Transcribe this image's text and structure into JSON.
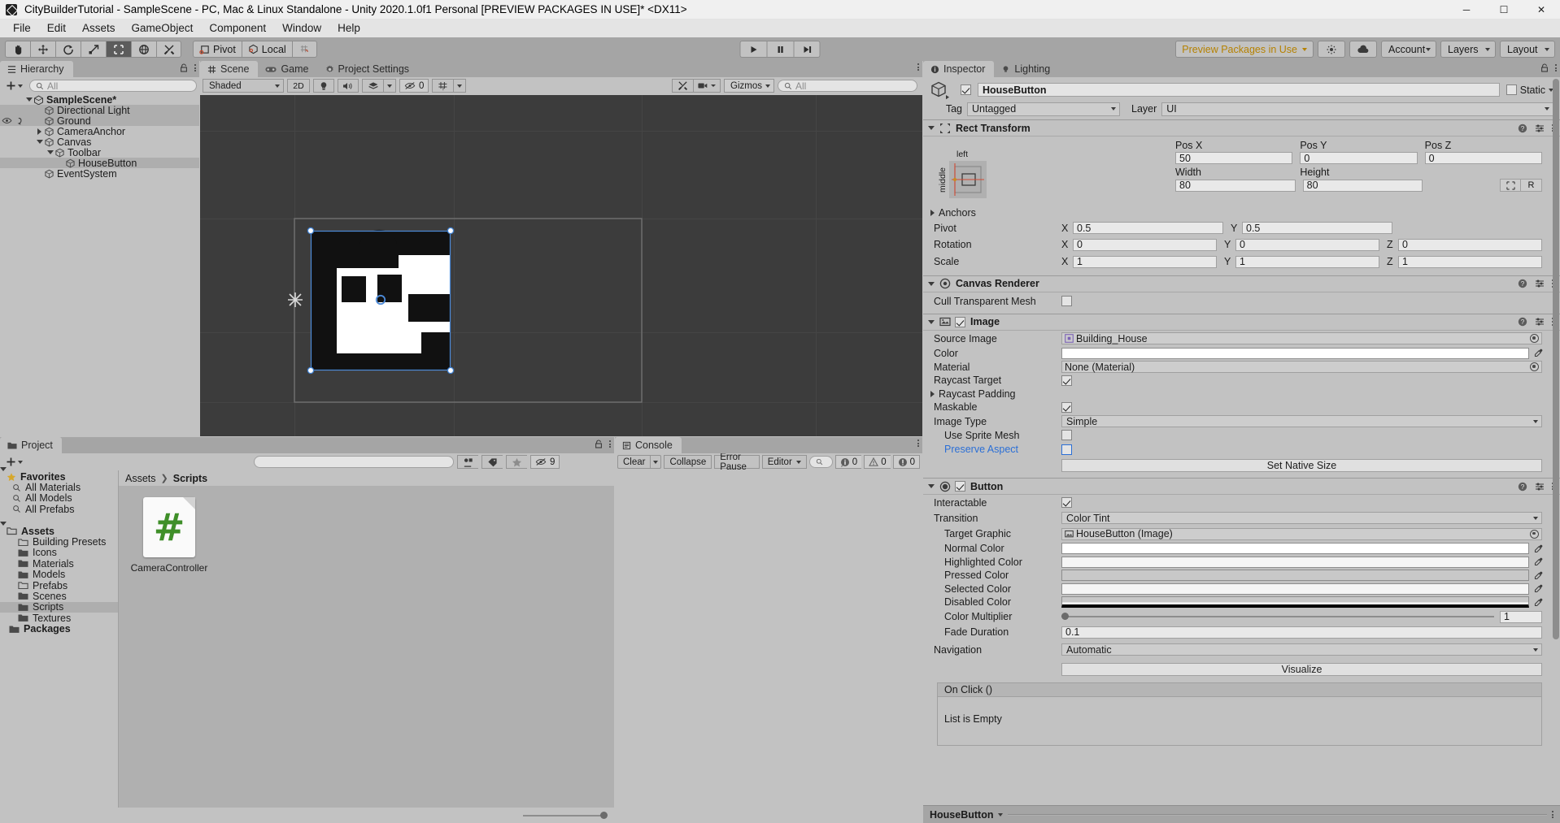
{
  "window": {
    "title": "CityBuilderTutorial - SampleScene - PC, Mac & Linux Standalone - Unity 2020.1.0f1 Personal [PREVIEW PACKAGES IN USE]* <DX11>",
    "minimize": "─",
    "maximize": "☐",
    "close": "✕"
  },
  "menu": {
    "items": [
      "File",
      "Edit",
      "Assets",
      "GameObject",
      "Component",
      "Window",
      "Help"
    ]
  },
  "toolbar": {
    "tools": [
      {
        "name": "hand-tool",
        "icon": "hand-icon",
        "active": false
      },
      {
        "name": "move-tool",
        "icon": "move-icon",
        "active": false
      },
      {
        "name": "rotate-tool",
        "icon": "rotate-icon",
        "active": false
      },
      {
        "name": "scale-tool",
        "icon": "scale-icon",
        "active": false
      },
      {
        "name": "rect-tool",
        "icon": "rect-icon",
        "active": true
      },
      {
        "name": "transform-tool",
        "icon": "transform-icon",
        "active": false
      },
      {
        "name": "custom-tool",
        "icon": "wrench-icon",
        "active": false
      }
    ],
    "pivot_label": "Pivot",
    "local_label": "Local",
    "grid_snap_label": "",
    "play": "▶",
    "pause": "‖",
    "step": "▶|",
    "preview_packages": "Preview Packages in Use",
    "account": "Account",
    "layers": "Layers",
    "layout": "Layout",
    "accent_gold": "#b58100"
  },
  "hierarchy": {
    "tab": "Hierarchy",
    "search_placeholder": "All",
    "rows": [
      {
        "label": "SampleScene*",
        "indent": 0,
        "foldout": "down",
        "bold": true,
        "scene": true,
        "selected": false
      },
      {
        "label": "Directional Light",
        "indent": 1,
        "foldout": "none",
        "bold": false,
        "scene": false,
        "selected": true
      },
      {
        "label": "Ground",
        "indent": 1,
        "foldout": "none",
        "bold": false,
        "scene": false,
        "selected": true,
        "eye": true
      },
      {
        "label": "CameraAnchor",
        "indent": 1,
        "foldout": "right",
        "bold": false,
        "scene": false,
        "selected": false
      },
      {
        "label": "Canvas",
        "indent": 1,
        "foldout": "down",
        "bold": false,
        "scene": false,
        "selected": false
      },
      {
        "label": "Toolbar",
        "indent": 2,
        "foldout": "down",
        "bold": false,
        "scene": false,
        "selected": false
      },
      {
        "label": "HouseButton",
        "indent": 3,
        "foldout": "none",
        "bold": false,
        "scene": false,
        "selected": true
      },
      {
        "label": "EventSystem",
        "indent": 1,
        "foldout": "none",
        "bold": false,
        "scene": false,
        "selected": false
      }
    ]
  },
  "scene_panel": {
    "tabs": [
      {
        "label": "Scene",
        "icon": "grid-icon",
        "active": true
      },
      {
        "label": "Game",
        "icon": "gamepad-icon",
        "active": false
      },
      {
        "label": "Project Settings",
        "icon": "gear-icon",
        "active": false
      }
    ],
    "draw_mode": "Shaded",
    "mode_2d": "2D",
    "gizmos_label": "Gizmos",
    "gizmos_search_placeholder": "All",
    "effects_count": "0"
  },
  "project": {
    "tab": "Project",
    "search_placeholder": "",
    "favorites_label": "Favorites",
    "favorites": [
      "All Materials",
      "All Models",
      "All Prefabs"
    ],
    "assets_label": "Assets",
    "folders": [
      {
        "label": "Building Presets",
        "empty": true,
        "selected": false
      },
      {
        "label": "Icons",
        "empty": false,
        "selected": false
      },
      {
        "label": "Materials",
        "empty": false,
        "selected": false
      },
      {
        "label": "Models",
        "empty": false,
        "selected": false
      },
      {
        "label": "Prefabs",
        "empty": true,
        "selected": false
      },
      {
        "label": "Scenes",
        "empty": false,
        "selected": false
      },
      {
        "label": "Scripts",
        "empty": false,
        "selected": true
      },
      {
        "label": "Textures",
        "empty": false,
        "selected": false
      }
    ],
    "packages_label": "Packages",
    "breadcrumb": [
      "Assets",
      "Scripts"
    ],
    "assets": [
      {
        "name": "CameraController",
        "type": "csharp-script",
        "glyph": "#",
        "color": "#3f8f29"
      }
    ],
    "filter_count": "9"
  },
  "console": {
    "tab": "Console",
    "clear_label": "Clear",
    "collapse_label": "Collapse",
    "error_pause_label": "Error Pause",
    "editor_label": "Editor",
    "search_placeholder": "",
    "counts": {
      "log": "0",
      "warning": "0",
      "error": "0"
    }
  },
  "inspector": {
    "tabs": [
      {
        "label": "Inspector",
        "icon": "info-icon",
        "active": true
      },
      {
        "label": "Lighting",
        "icon": "light-icon",
        "active": false
      }
    ],
    "object_name": "HouseButton",
    "object_enabled": true,
    "static_label": "Static",
    "tag_label": "Tag",
    "tag_value": "Untagged",
    "layer_label": "Layer",
    "layer_value": "UI",
    "rect_transform": {
      "title": "Rect Transform",
      "anchor_preset_h": "left",
      "anchor_preset_v": "middle",
      "pos_x_label": "Pos X",
      "pos_x": "50",
      "pos_y_label": "Pos Y",
      "pos_y": "0",
      "pos_z_label": "Pos Z",
      "pos_z": "0",
      "width_label": "Width",
      "width": "80",
      "height_label": "Height",
      "height": "80",
      "blueprint_label": "R",
      "anchors_label": "Anchors",
      "pivot_label": "Pivot",
      "pivot_x": "0.5",
      "pivot_y": "0.5",
      "rotation_label": "Rotation",
      "rot_x": "0",
      "rot_y": "0",
      "rot_z": "0",
      "scale_label": "Scale",
      "scale_x": "1",
      "scale_y": "1",
      "scale_z": "1"
    },
    "canvas_renderer": {
      "title": "Canvas Renderer",
      "cull_label": "Cull Transparent Mesh",
      "cull_checked": false
    },
    "image": {
      "title": "Image",
      "enabled": true,
      "source_image_label": "Source Image",
      "source_image_value": "Building_House",
      "color_label": "Color",
      "color_value": "#ffffff",
      "material_label": "Material",
      "material_value": "None (Material)",
      "raycast_target_label": "Raycast Target",
      "raycast_target_checked": true,
      "raycast_padding_label": "Raycast Padding",
      "maskable_label": "Maskable",
      "maskable_checked": true,
      "image_type_label": "Image Type",
      "image_type_value": "Simple",
      "use_sprite_mesh_label": "Use Sprite Mesh",
      "use_sprite_mesh_checked": false,
      "preserve_aspect_label": "Preserve Aspect",
      "preserve_aspect_checked": false,
      "set_native_size_label": "Set Native Size"
    },
    "button": {
      "title": "Button",
      "enabled": true,
      "interactable_label": "Interactable",
      "interactable_checked": true,
      "transition_label": "Transition",
      "transition_value": "Color Tint",
      "target_graphic_label": "Target Graphic",
      "target_graphic_value": "HouseButton (Image)",
      "normal_color_label": "Normal Color",
      "normal_color": "#ffffff",
      "highlighted_color_label": "Highlighted Color",
      "highlighted_color": "#f5f5f5",
      "pressed_color_label": "Pressed Color",
      "pressed_color": "#c8c8c8",
      "selected_color_label": "Selected Color",
      "selected_color": "#f5f5f5",
      "disabled_color_label": "Disabled Color",
      "disabled_color": "#c8c8c8",
      "color_multiplier_label": "Color Multiplier",
      "color_multiplier": "1",
      "fade_duration_label": "Fade Duration",
      "fade_duration": "0.1",
      "navigation_label": "Navigation",
      "navigation_value": "Automatic",
      "visualize_label": "Visualize",
      "on_click_label": "On Click ()",
      "on_click_empty": "List is Empty"
    },
    "footer_name": "HouseButton"
  }
}
